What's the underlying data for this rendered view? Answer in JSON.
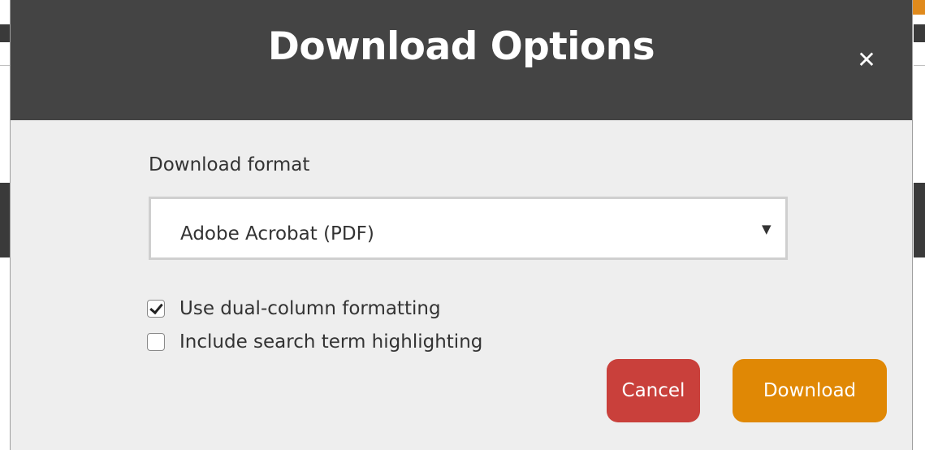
{
  "dialog": {
    "title": "Download Options",
    "close_label": "✕"
  },
  "format": {
    "label": "Download format",
    "selected": "Adobe Acrobat (PDF)",
    "arrow": "▼"
  },
  "options": [
    {
      "label": "Use dual-column formatting",
      "checked": true
    },
    {
      "label": "Include search term highlighting",
      "checked": false
    }
  ],
  "buttons": {
    "cancel_label": "Cancel",
    "download_label": "Download"
  },
  "colors": {
    "header_bg": "#444444",
    "body_bg": "#eeeeee",
    "cancel_bg": "#c9403b",
    "download_bg": "#e08805"
  }
}
